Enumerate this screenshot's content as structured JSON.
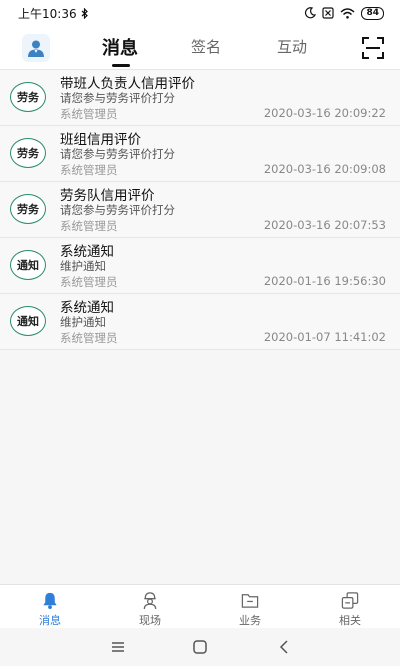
{
  "status_bar": {
    "time": "上午10:36",
    "battery": "84"
  },
  "header": {
    "tabs": [
      {
        "label": "消息",
        "active": true
      },
      {
        "label": "签名",
        "active": false
      },
      {
        "label": "互动",
        "active": false
      }
    ]
  },
  "messages": [
    {
      "badge": "劳务",
      "title": "带班人负责人信用评价",
      "subtitle": "请您参与劳务评价打分",
      "sender": "系统管理员",
      "time": "2020-03-16 20:09:22"
    },
    {
      "badge": "劳务",
      "title": "班组信用评价",
      "subtitle": "请您参与劳务评价打分",
      "sender": "系统管理员",
      "time": "2020-03-16 20:09:08"
    },
    {
      "badge": "劳务",
      "title": "劳务队信用评价",
      "subtitle": "请您参与劳务评价打分",
      "sender": "系统管理员",
      "time": "2020-03-16 20:07:53"
    },
    {
      "badge": "通知",
      "title": "系统通知",
      "subtitle": "维护通知",
      "sender": "系统管理员",
      "time": "2020-01-16 19:56:30"
    },
    {
      "badge": "通知",
      "title": "系统通知",
      "subtitle": "维护通知",
      "sender": "系统管理员",
      "time": "2020-01-07 11:41:02"
    }
  ],
  "bottom_nav": [
    {
      "label": "消息",
      "icon": "bell-icon",
      "active": true
    },
    {
      "label": "现场",
      "icon": "worker-icon",
      "active": false
    },
    {
      "label": "业务",
      "icon": "folder-icon",
      "active": false
    },
    {
      "label": "相关",
      "icon": "copy-icon",
      "active": false
    }
  ],
  "colors": {
    "accent": "#2f7ed8",
    "badge_border": "#2a8a6e"
  }
}
